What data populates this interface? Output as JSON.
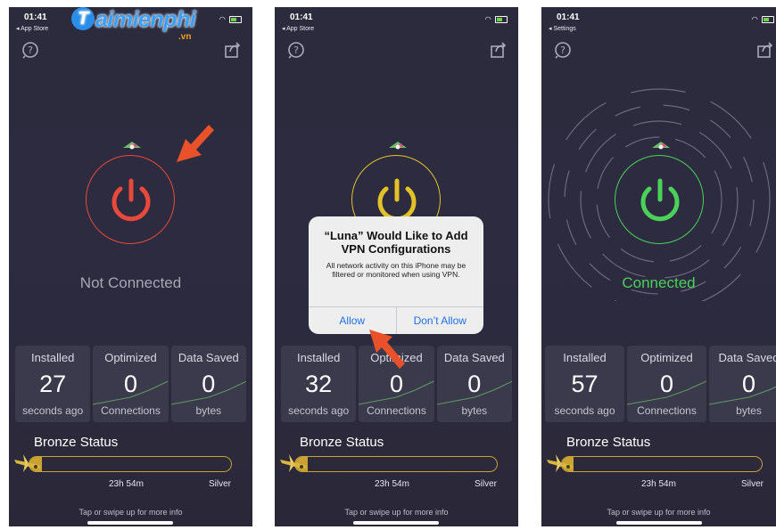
{
  "logo": {
    "name": "aimienphi",
    "initial": "T",
    "suffix": ".vn"
  },
  "screens": [
    {
      "status_time": "01:41",
      "back_label": "◂ App Store",
      "state_text": "Not Connected",
      "state_color": "#a6a6b3",
      "accent": "#e8493a",
      "stats": [
        {
          "top": "Installed",
          "value": "27",
          "bottom": "seconds ago"
        },
        {
          "top": "Optimized",
          "value": "0",
          "bottom": "Connections"
        },
        {
          "top": "Data Saved",
          "value": "0",
          "bottom": "bytes"
        }
      ],
      "bronze_label": "Bronze Status",
      "progress": 0.06,
      "time_left": "23h 54m",
      "tier": "Silver",
      "hint": "Tap or swipe up for more info"
    },
    {
      "status_time": "01:41",
      "back_label": "◂ App Store",
      "accent": "#e2c227",
      "stats": [
        {
          "top": "Installed",
          "value": "32",
          "bottom": "seconds ago"
        },
        {
          "top": "Optimized",
          "value": "0",
          "bottom": "Connections"
        },
        {
          "top": "Data Saved",
          "value": "0",
          "bottom": "bytes"
        }
      ],
      "bronze_label": "Bronze Status",
      "progress": 0.06,
      "time_left": "23h 54m",
      "tier": "Silver",
      "hint": "Tap or swipe up for more info",
      "dialog": {
        "title": "“Luna” Would Like to Add VPN Configurations",
        "message": "All network activity on this iPhone may be filtered or monitored when using VPN.",
        "allow": "Allow",
        "deny": "Don’t Allow"
      }
    },
    {
      "status_time": "01:41",
      "back_label": "◂ Settings",
      "state_text": "Connected",
      "state_color": "#4bd05a",
      "accent": "#4bd05a",
      "stats": [
        {
          "top": "Installed",
          "value": "57",
          "bottom": "seconds ago"
        },
        {
          "top": "Optimized",
          "value": "0",
          "bottom": "Connections"
        },
        {
          "top": "Data Saved",
          "value": "0",
          "bottom": "bytes"
        }
      ],
      "bronze_label": "Bronze Status",
      "progress": 0.06,
      "time_left": "23h 54m",
      "tier": "Silver",
      "hint": "Tap or swipe up for more info"
    }
  ],
  "colors": {
    "arrow": "#e8512a",
    "bar": "#c8a233",
    "panel": "#3a3a4c",
    "background": "#2b2b3d",
    "sparkline": "#5f9a5f"
  }
}
